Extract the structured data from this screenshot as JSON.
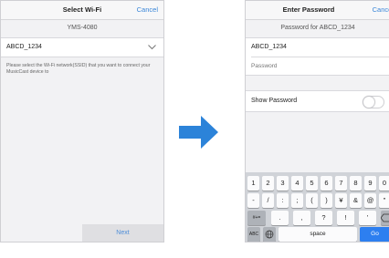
{
  "left_screen": {
    "nav_title": "Select Wi-Fi",
    "cancel_label": "Cancel",
    "device_name": "YMS-4080",
    "selected_ssid": "ABCD_1234",
    "description": "Please select the Wi-Fi network(SSID) that you want to connect your MusicCast device to",
    "next_label": "Next",
    "chevron_icon": "chevron-down-icon"
  },
  "arrow_icon": "arrow-right-icon",
  "arrow_color": "#2c83d9",
  "right_screen": {
    "nav_title": "Enter Password",
    "cancel_label": "Cancel",
    "password_for": "Password for ABCD_1234",
    "ssid": "ABCD_1234",
    "password_placeholder": "Password",
    "show_password_label": "Show Password",
    "show_password_on": false,
    "keyboard": {
      "row1": [
        "1",
        "2",
        "3",
        "4",
        "5",
        "6",
        "7",
        "8",
        "9",
        "0"
      ],
      "row2": [
        "-",
        "/",
        ":",
        ";",
        "(",
        ")",
        "¥",
        "&",
        "@",
        "\""
      ],
      "mode_key": "#+=",
      "row3": [
        ".",
        ",",
        "?",
        "!",
        "'"
      ],
      "delete_icon": "backspace-icon",
      "abc_key": "ABC",
      "globe_icon": "globe-icon",
      "space_label": "space",
      "go_label": "Go"
    }
  }
}
